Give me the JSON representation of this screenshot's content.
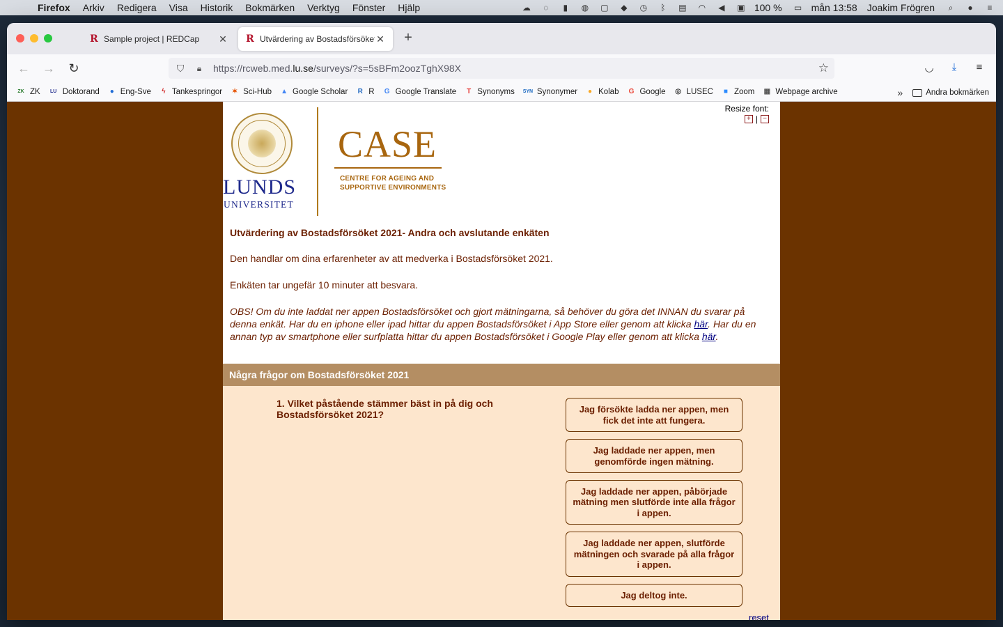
{
  "menubar": {
    "app": "Firefox",
    "items": [
      "Arkiv",
      "Redigera",
      "Visa",
      "Historik",
      "Bokmärken",
      "Verktyg",
      "Fönster",
      "Hjälp"
    ],
    "battery": "100 %",
    "clock": "mån 13:58",
    "user": "Joakim Frögren"
  },
  "tabs": [
    {
      "title": "Sample project | REDCap"
    },
    {
      "title": "Utvärdering av Bostadsförsöket"
    }
  ],
  "urlbar": {
    "prefix": "https://rcweb.med.",
    "domain": "lu.se",
    "suffix": "/surveys/?s=5sBFm2oozTghX98X"
  },
  "bookmarks": [
    {
      "label": "ZK",
      "icon": "zk-icon",
      "color": "#2e7d32",
      "glyph": "ZK"
    },
    {
      "label": "Doktorand",
      "icon": "lu-icon",
      "color": "#1f2a8c",
      "glyph": "LU"
    },
    {
      "label": "Eng-Sve",
      "icon": "speech-bubble-icon",
      "color": "#1e6bd6",
      "glyph": "●"
    },
    {
      "label": "Tankespringor",
      "icon": "bolt-icon",
      "color": "#d32f2f",
      "glyph": "ϟ"
    },
    {
      "label": "Sci-Hub",
      "icon": "raven-icon",
      "color": "#e65100",
      "glyph": "✶"
    },
    {
      "label": "Google Scholar",
      "icon": "scholar-cap-icon",
      "color": "#4285f4",
      "glyph": "▲"
    },
    {
      "label": "R",
      "icon": "r-logo-icon",
      "color": "#276dc3",
      "glyph": "R"
    },
    {
      "label": "Google Translate",
      "icon": "translate-icon",
      "color": "#4285f4",
      "glyph": "G"
    },
    {
      "label": "Synonyms",
      "icon": "thesaurus-icon",
      "color": "#e53935",
      "glyph": "T"
    },
    {
      "label": "Synonymer",
      "icon": "syn-icon",
      "color": "#1565c0",
      "glyph": "SYN"
    },
    {
      "label": "Kolab",
      "icon": "kolab-icon",
      "color": "#f9a825",
      "glyph": "●"
    },
    {
      "label": "Google",
      "icon": "google-icon",
      "color": "#ea4335",
      "glyph": "G"
    },
    {
      "label": "LUSEC",
      "icon": "lusec-icon",
      "color": "#333333",
      "glyph": "◎"
    },
    {
      "label": "Zoom",
      "icon": "zoom-icon",
      "color": "#2d8cff",
      "glyph": "■"
    },
    {
      "label": "Webpage archive",
      "icon": "archive-icon",
      "color": "#555555",
      "glyph": "▦"
    }
  ],
  "bookmarks_folder": "Andra bokmärken",
  "page": {
    "logo_lu_line1": "LUNDS",
    "logo_lu_line2": "UNIVERSITET",
    "logo_case": "CASE",
    "logo_case_sub1": "CENTRE FOR AGEING AND",
    "logo_case_sub2": "SUPPORTIVE ENVIRONMENTS",
    "resize_label": "Resize font:",
    "survey_title": "Utvärdering av Bostadsförsöket 2021- Andra och avslutande enkäten",
    "intro1": "Den handlar om dina erfarenheter av att medverka i Bostadsförsöket 2021.",
    "intro2": "Enkäten tar ungefär 10 minuter att besvara.",
    "obs_part1": "OBS! Om du inte laddat ner appen Bostadsförsöket och gjort mätningarna, så behöver du göra det INNAN du svarar på denna enkät. Har du en iphone eller ipad hittar du appen Bostadsförsöket i App Store eller genom att klicka ",
    "obs_link1": "här",
    "obs_part2": ". Har du en annan typ av smartphone eller surfplatta hittar du appen Bostadsförsöket i Google Play eller genom att klicka ",
    "obs_link2": "här",
    "obs_part3": ".",
    "section_header": "Några frågor om Bostadsförsöket 2021",
    "question1": "1. Vilket påstående stämmer bäst in på dig och Bostadsförsöket 2021?",
    "options": [
      "Jag försökte ladda ner appen, men fick det inte att fungera.",
      "Jag laddade ner appen, men genomförde ingen mätning.",
      "Jag laddade ner appen, påbörjade mätning men slutförde inte alla frågor i appen.",
      "Jag laddade ner appen, slutförde mätningen och svarade på alla frågor i appen.",
      "Jag deltog inte."
    ],
    "reset": "reset"
  }
}
